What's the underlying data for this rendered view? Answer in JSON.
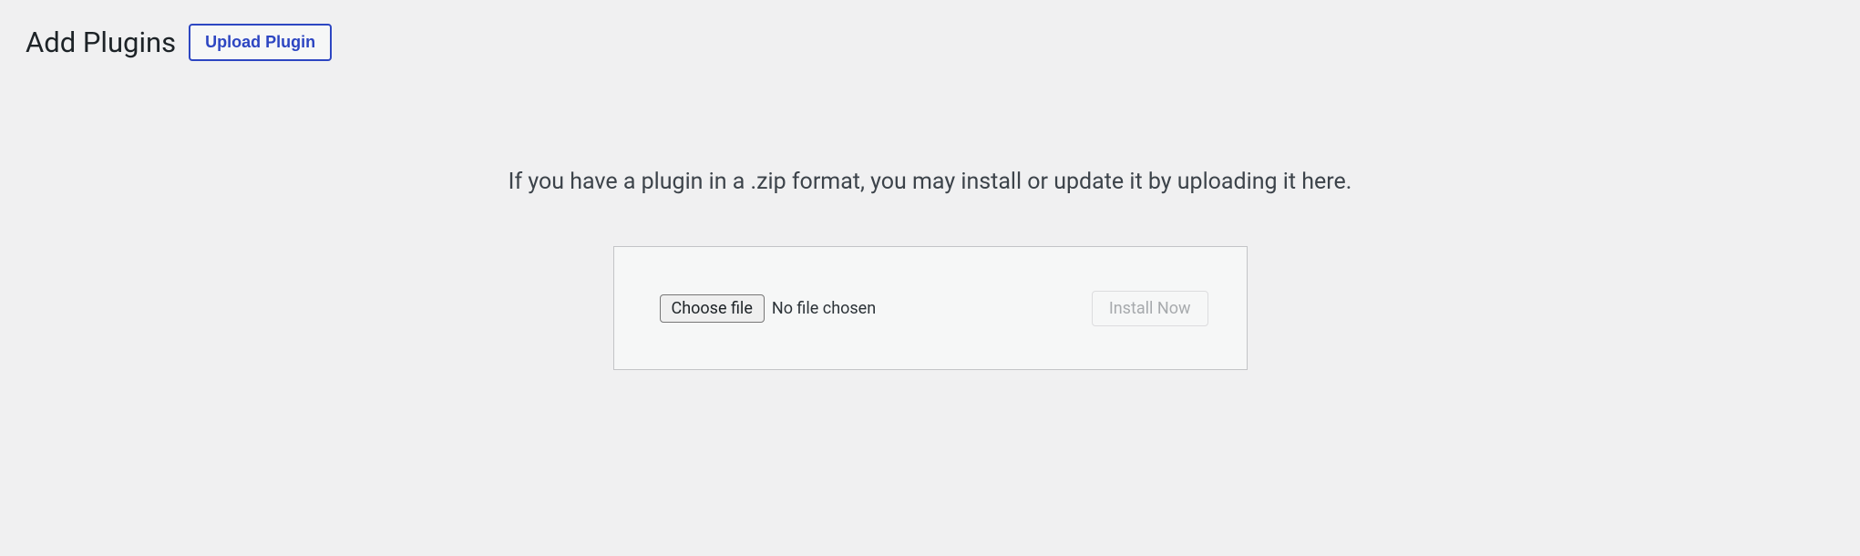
{
  "header": {
    "title": "Add Plugins",
    "upload_button": "Upload Plugin"
  },
  "upload": {
    "description": "If you have a plugin in a .zip format, you may install or update it by uploading it here.",
    "choose_file_label": "Choose file",
    "file_status": "No file chosen",
    "install_button": "Install Now"
  }
}
